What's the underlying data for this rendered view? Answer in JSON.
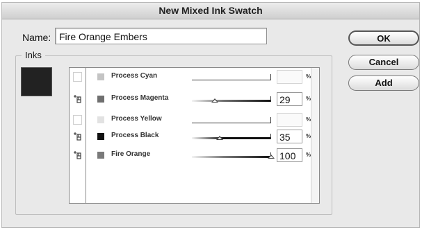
{
  "dialog": {
    "title": "New Mixed Ink Swatch",
    "name_label": "Name:",
    "name_value": "Fire Orange Embers",
    "inks_label": "Inks",
    "preview_color": "#222222"
  },
  "buttons": {
    "ok": "OK",
    "cancel": "Cancel",
    "add": "Add"
  },
  "inks": [
    {
      "name": "Process Cyan",
      "included": false,
      "swatch_color": "#c4c4c4",
      "percent": "",
      "level": 0,
      "percent_sign": "%"
    },
    {
      "name": "Process Magenta",
      "included": true,
      "swatch_color": "#6f6f6f",
      "percent": "29",
      "level": 0.29,
      "percent_sign": "%"
    },
    {
      "name": "Process Yellow",
      "included": false,
      "swatch_color": "#e2e2e2",
      "percent": "",
      "level": 0,
      "percent_sign": "%"
    },
    {
      "name": "Process Black",
      "included": true,
      "swatch_color": "#111111",
      "percent": "35",
      "level": 0.35,
      "percent_sign": "%"
    },
    {
      "name": "Fire Orange",
      "included": true,
      "swatch_color": "#7a7a7a",
      "percent": "100",
      "level": 1.0,
      "percent_sign": "%"
    }
  ],
  "icons": {
    "include_toggle": "ink-include-icon"
  }
}
